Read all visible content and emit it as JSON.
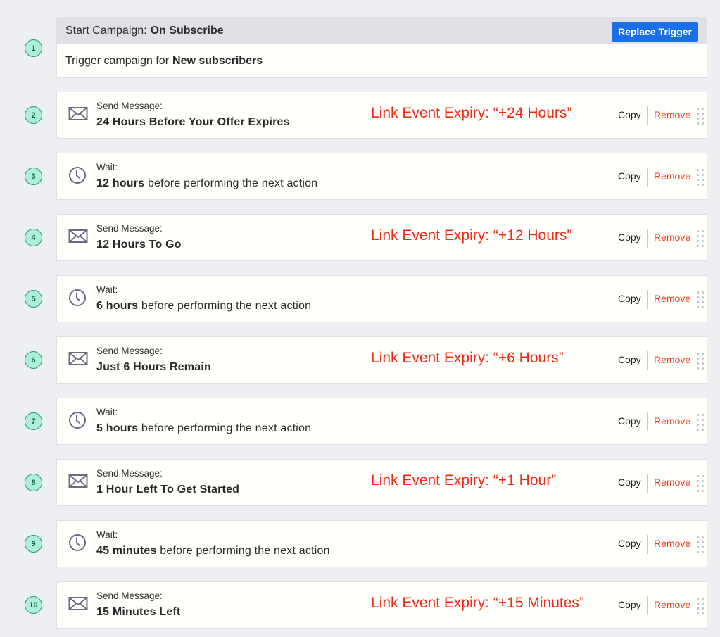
{
  "trigger": {
    "step_number": "1",
    "title_prefix": "Start Campaign:",
    "title_value": "On Subscribe",
    "replace_button_label": "Replace Trigger",
    "body_prefix": "Trigger campaign for",
    "body_value": "New subscribers"
  },
  "actions_labels": {
    "copy": "Copy",
    "remove": "Remove"
  },
  "steps": [
    {
      "number": "2",
      "type": "send",
      "icon": "envelope-icon",
      "label": "Send Message:",
      "bold": "24 Hours Before Your Offer Expires",
      "rest": "",
      "annotation": "Link Event Expiry: “+24 Hours”"
    },
    {
      "number": "3",
      "type": "wait",
      "icon": "clock-icon",
      "label": "Wait:",
      "bold": "12 hours",
      "rest": " before performing the next action",
      "annotation": ""
    },
    {
      "number": "4",
      "type": "send",
      "icon": "envelope-icon",
      "label": "Send Message:",
      "bold": "12 Hours To Go",
      "rest": "",
      "annotation": "Link Event Expiry: “+12 Hours”"
    },
    {
      "number": "5",
      "type": "wait",
      "icon": "clock-icon",
      "label": "Wait:",
      "bold": "6 hours",
      "rest": " before performing the next action",
      "annotation": ""
    },
    {
      "number": "6",
      "type": "send",
      "icon": "envelope-icon",
      "label": "Send Message:",
      "bold": "Just 6 Hours Remain",
      "rest": "",
      "annotation": "Link Event Expiry: “+6 Hours”"
    },
    {
      "number": "7",
      "type": "wait",
      "icon": "clock-icon",
      "label": "Wait:",
      "bold": "5 hours",
      "rest": " before performing the next action",
      "annotation": ""
    },
    {
      "number": "8",
      "type": "send",
      "icon": "envelope-icon",
      "label": "Send Message:",
      "bold": "1 Hour Left To Get Started",
      "rest": "",
      "annotation": "Link Event Expiry: “+1 Hour”"
    },
    {
      "number": "9",
      "type": "wait",
      "icon": "clock-icon",
      "label": "Wait:",
      "bold": "45 minutes",
      "rest": " before performing the next action",
      "annotation": ""
    },
    {
      "number": "10",
      "type": "send",
      "icon": "envelope-icon",
      "label": "Send Message:",
      "bold": "15 Minutes Left",
      "rest": "",
      "annotation": "Link Event Expiry: “+15 Minutes”"
    }
  ],
  "colors": {
    "accent_blue": "#1a6ee8",
    "remove_red": "#f03c1e",
    "annotation_red": "#f02a16",
    "badge_fill": "#aeefd9",
    "badge_border": "#1f9c72"
  }
}
